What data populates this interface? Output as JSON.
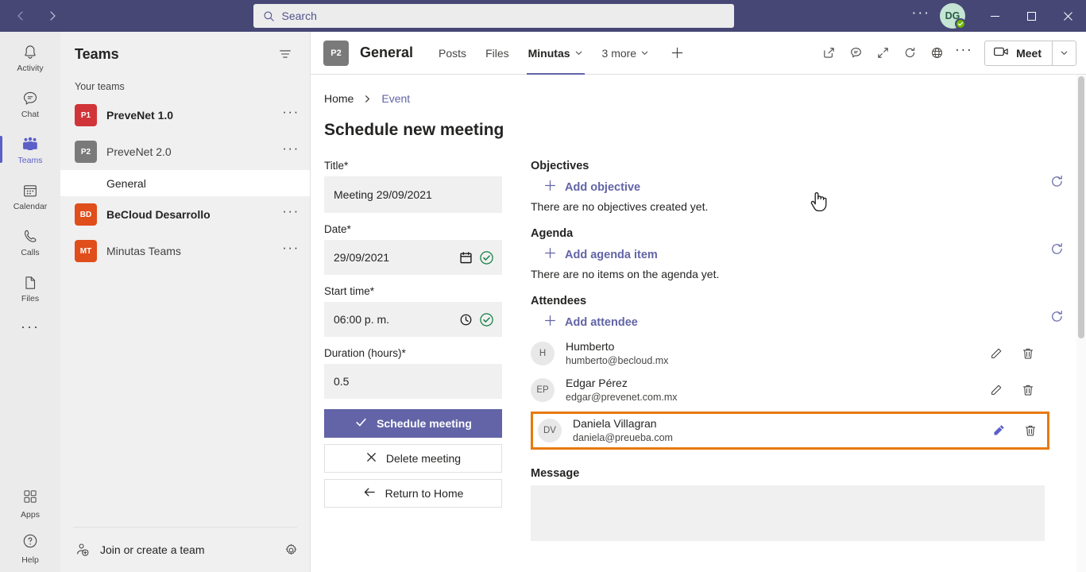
{
  "titlebar": {
    "back_icon": "chevron-left-icon",
    "forward_icon": "chevron-right-icon",
    "search": {
      "placeholder": "Search",
      "value": "",
      "icon": "search-icon"
    },
    "more_label": "···",
    "avatar": {
      "initials": "DG",
      "presence": "available",
      "bg": "#c5e5d4"
    },
    "window": {
      "minimize": "—",
      "maximize": "□",
      "close": "✕"
    }
  },
  "rail": {
    "items": [
      {
        "label": "Activity",
        "icon": "bell-icon",
        "active": false
      },
      {
        "label": "Chat",
        "icon": "chat-icon",
        "active": false
      },
      {
        "label": "Teams",
        "icon": "teams-icon",
        "active": true
      },
      {
        "label": "Calendar",
        "icon": "calendar-icon",
        "active": false
      },
      {
        "label": "Calls",
        "icon": "phone-icon",
        "active": false
      },
      {
        "label": "Files",
        "icon": "file-icon",
        "active": false
      }
    ],
    "more_label": "···",
    "apps": {
      "label": "Apps",
      "icon": "apps-icon"
    },
    "help": {
      "label": "Help",
      "icon": "help-icon"
    }
  },
  "teams_pane": {
    "title": "Teams",
    "filter_icon": "filter-icon",
    "section_label": "Your teams",
    "teams": [
      {
        "initials": "P1",
        "name": "PreveNet 1.0",
        "color": "#d13438",
        "bold": true,
        "more": "···"
      },
      {
        "initials": "P2",
        "name": "PreveNet 2.0",
        "color": "#7a7a7a",
        "bold": false,
        "more": "···"
      },
      {
        "initials": "BD",
        "name": "BeCloud Desarrollo",
        "color": "#e04e1b",
        "bold": true,
        "more": "···"
      },
      {
        "initials": "MT",
        "name": "Minutas Teams",
        "color": "#e04e1b",
        "bold": false,
        "more": "···"
      }
    ],
    "channel": {
      "name": "General",
      "selected": true
    },
    "footer": {
      "label": "Join or create a team",
      "icon": "person-add-icon",
      "settings_icon": "gear-icon"
    }
  },
  "channel_header": {
    "badge": "P2",
    "title": "General",
    "tabs": [
      {
        "label": "Posts",
        "active": false,
        "chevron": false
      },
      {
        "label": "Files",
        "active": false,
        "chevron": false
      },
      {
        "label": "Minutas",
        "active": true,
        "chevron": true
      },
      {
        "label": "3 more",
        "active": false,
        "chevron": true
      }
    ],
    "add_tab_icon": "plus-icon",
    "icons": [
      {
        "name": "popout-icon"
      },
      {
        "name": "chat-bubble-icon"
      },
      {
        "name": "expand-icon"
      },
      {
        "name": "refresh-icon"
      },
      {
        "name": "globe-icon"
      }
    ],
    "more_label": "···",
    "meet": {
      "label": "Meet",
      "icon": "camera-icon",
      "dropdown_icon": "chevron-down-icon"
    }
  },
  "page": {
    "breadcrumb": [
      {
        "label": "Home",
        "link": false
      },
      {
        "label": "Event",
        "link": true
      }
    ],
    "breadcrumb_sep_icon": "chevron-right-icon",
    "title": "Schedule new meeting",
    "form": {
      "title_field": {
        "label": "Title*",
        "value": "Meeting  29/09/2021"
      },
      "date_field": {
        "label": "Date*",
        "value": "29/09/2021",
        "picker_icon": "calendar-icon",
        "valid_icon": "check-circle-icon"
      },
      "start_time_field": {
        "label": "Start time*",
        "value": "06:00 p. m.",
        "picker_icon": "clock-icon",
        "valid_icon": "check-circle-icon"
      },
      "duration_field": {
        "label": "Duration (hours)*",
        "value": "0.5"
      },
      "buttons": [
        {
          "label": "Schedule meeting",
          "icon": "check-icon",
          "style": "primary"
        },
        {
          "label": "Delete meeting",
          "icon": "close-icon",
          "style": "ghost"
        },
        {
          "label": "Return to Home",
          "icon": "arrow-left-icon",
          "style": "ghost"
        }
      ]
    },
    "objectives": {
      "title": "Objectives",
      "add_label": "Add objective",
      "empty_text": "There are no objectives created yet.",
      "refresh_icon": "refresh-icon"
    },
    "agenda": {
      "title": "Agenda",
      "add_label": "Add agenda item",
      "empty_text": "There are no items on the agenda yet.",
      "refresh_icon": "refresh-icon"
    },
    "attendees": {
      "title": "Attendees",
      "add_label": "Add attendee",
      "refresh_icon": "refresh-icon",
      "list": [
        {
          "initials": "H",
          "name": "Humberto",
          "email": "humberto@becloud.mx",
          "edit_icon": "pencil-icon",
          "delete_icon": "trash-icon",
          "highlighted": false
        },
        {
          "initials": "EP",
          "name": "Edgar Pérez",
          "email": "edgar@prevenet.com.mx",
          "edit_icon": "pencil-icon",
          "delete_icon": "trash-icon",
          "highlighted": false
        },
        {
          "initials": "DV",
          "name": "Daniela Villagran",
          "email": "daniela@preueba.com",
          "edit_icon": "pencil-icon",
          "delete_icon": "trash-icon",
          "highlighted": true
        }
      ]
    },
    "message": {
      "label": "Message",
      "value": "",
      "placeholder": ""
    }
  },
  "highlight": {
    "color": "#e8790c",
    "target": "edit-attendee-daniela-villagran"
  },
  "colors": {
    "brand_purple": "#6264a7",
    "title_bar": "#464775",
    "accent_link": "#6264a7",
    "success_green": "#107c41",
    "highlight_orange": "#e8790c"
  }
}
